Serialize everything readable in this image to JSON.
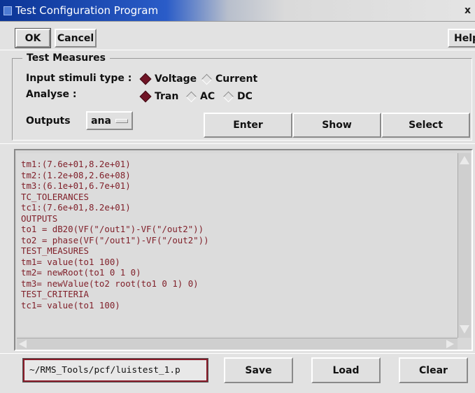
{
  "window": {
    "title": "Test Configuration Program",
    "close_glyph": "x"
  },
  "toolbar": {
    "ok_label": "OK",
    "cancel_label": "Cancel",
    "help_label": "Help"
  },
  "test_measures": {
    "group_title": "Test Measures",
    "input_stimuli_label": "Input stimuli type :",
    "input_options": [
      {
        "label": "Voltage",
        "selected": true
      },
      {
        "label": "Current",
        "selected": false
      }
    ],
    "analyse_label": "Analyse :",
    "analyse_options": [
      {
        "label": "Tran",
        "selected": true
      },
      {
        "label": "AC",
        "selected": false
      },
      {
        "label": "DC",
        "selected": false
      }
    ],
    "outputs_label": "Outputs",
    "outputs_value": "ana",
    "enter_label": "Enter",
    "show_label": "Show",
    "select_label": "Select"
  },
  "text_area": {
    "lines": [
      "tm1:(7.6e+01,8.2e+01)",
      "tm2:(1.2e+08,2.6e+08)",
      "tm3:(6.1e+01,6.7e+01)",
      "TC_TOLERANCES",
      "tc1:(7.6e+01,8.2e+01)",
      "OUTPUTS",
      "to1 = dB20(VF(\"/out1\")-VF(\"/out2\"))",
      "to2 = phase(VF(\"/out1\")-VF(\"/out2\"))",
      "TEST_MEASURES",
      "tm1= value(to1 100)",
      "tm2= newRoot(to1 0 1 0)",
      "tm3= newValue(to2 root(to1 0 1) 0)",
      "TEST_CRITERIA",
      "tc1= value(to1 100)"
    ]
  },
  "file": {
    "path_value": "~/RMS_Tools/pcf/luistest_1.p",
    "save_label": "Save",
    "load_label": "Load",
    "clear_label": "Clear"
  },
  "colors": {
    "accent": "#701426",
    "title_bar": "#0c3596",
    "text": "#80202a"
  }
}
